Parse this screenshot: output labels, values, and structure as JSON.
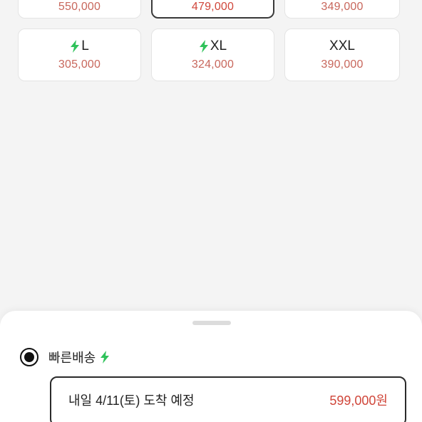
{
  "sizes": {
    "row1": [
      {
        "label": "",
        "price": "550,000",
        "fast": false
      },
      {
        "label": "",
        "price": "479,000",
        "fast": false,
        "selected": true
      },
      {
        "label": "",
        "price": "349,000",
        "fast": false
      }
    ],
    "row2": [
      {
        "label": "L",
        "price": "305,000",
        "fast": true
      },
      {
        "label": "XL",
        "price": "324,000",
        "fast": true
      },
      {
        "label": "XXL",
        "price": "390,000",
        "fast": false
      }
    ]
  },
  "shipping": {
    "option_label": "빠른배송",
    "option_icon": "lightning-icon",
    "delivery_text": "내일 4/11(토) 도착 예정",
    "delivery_price": "599,000원"
  },
  "colors": {
    "price": "#c8675c",
    "accent_price": "#d0463a",
    "bolt": "#2fc25a"
  }
}
